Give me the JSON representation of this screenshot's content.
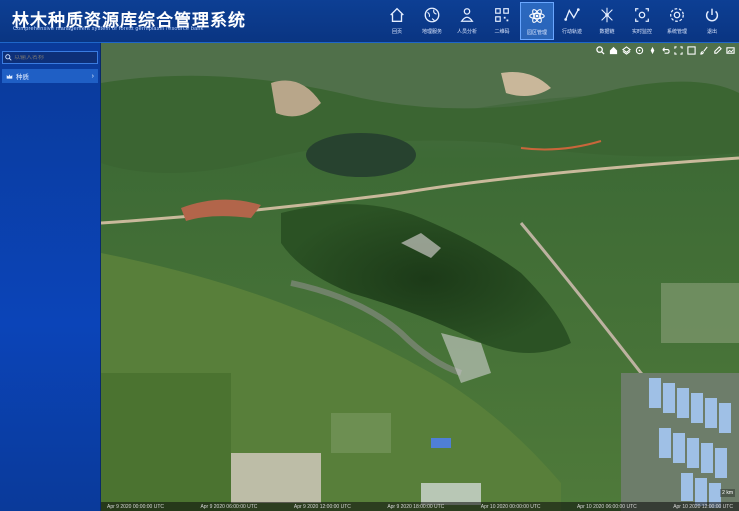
{
  "app": {
    "title": "林木种质资源库综合管理系统",
    "subtitle": "Comprehensive management system of forest germplasm resource bank"
  },
  "nav": [
    {
      "label": "回页",
      "icon": "home-icon"
    },
    {
      "label": "地理服务",
      "icon": "globe-icon"
    },
    {
      "label": "人员分析",
      "icon": "person-stats-icon"
    },
    {
      "label": "二维码",
      "icon": "qrcode-icon"
    },
    {
      "label": "园区管理",
      "icon": "atom-icon",
      "active": true
    },
    {
      "label": "行动轨迹",
      "icon": "route-icon"
    },
    {
      "label": "数据链",
      "icon": "network-icon"
    },
    {
      "label": "实时监控",
      "icon": "monitor-icon"
    },
    {
      "label": "系统管理",
      "icon": "gear-icon"
    },
    {
      "label": "退出",
      "icon": "power-icon"
    }
  ],
  "sidebar": {
    "search_placeholder": "以输入名称",
    "tree_item": "种质"
  },
  "map": {
    "zoom_label": "2 km",
    "timeline": [
      "Apr 9 2020 00:00:00 UTC",
      "Apr 9 2020 06:00:00 UTC",
      "Apr 9 2020 12:00:00 UTC",
      "Apr 9 2020 18:00:00 UTC",
      "Apr 10 2020 00:00:00 UTC",
      "Apr 10 2020 06:00:00 UTC",
      "Apr 10 2020 12:00:00 UTC"
    ]
  },
  "colors": {
    "header": "#0a3582",
    "sidebar": "#0b44b8",
    "active": "#3f8ee6"
  }
}
